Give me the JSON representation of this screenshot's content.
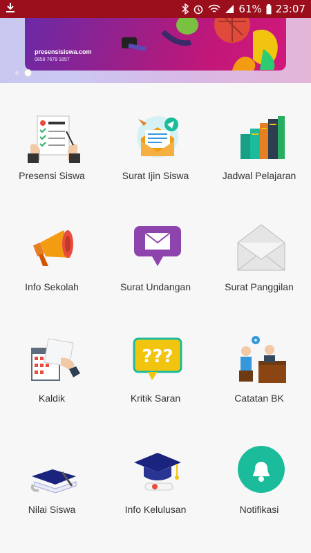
{
  "status_bar": {
    "battery": "61%",
    "time": "23:07"
  },
  "banner": {
    "brand": "presensisiswa.com",
    "phone": "0858 7679 1857"
  },
  "menu": [
    {
      "label": "Presensi Siswa",
      "icon": "attendance-checklist-icon"
    },
    {
      "label": "Surat Ijin Siswa",
      "icon": "permission-letter-icon"
    },
    {
      "label": "Jadwal Pelajaran",
      "icon": "books-icon"
    },
    {
      "label": "Info Sekolah",
      "icon": "megaphone-icon"
    },
    {
      "label": "Surat Undangan",
      "icon": "invitation-message-icon"
    },
    {
      "label": "Surat Panggilan",
      "icon": "envelope-icon"
    },
    {
      "label": "Kaldik",
      "icon": "calendar-icon"
    },
    {
      "label": "Kritik Saran",
      "icon": "question-bubble-icon"
    },
    {
      "label": "Catatan BK",
      "icon": "counseling-icon"
    },
    {
      "label": "Nilai Siswa",
      "icon": "diploma-book-icon"
    },
    {
      "label": "Info Kelulusan",
      "icon": "graduation-cap-icon"
    },
    {
      "label": "Notifikasi",
      "icon": "notification-bell-icon"
    }
  ]
}
